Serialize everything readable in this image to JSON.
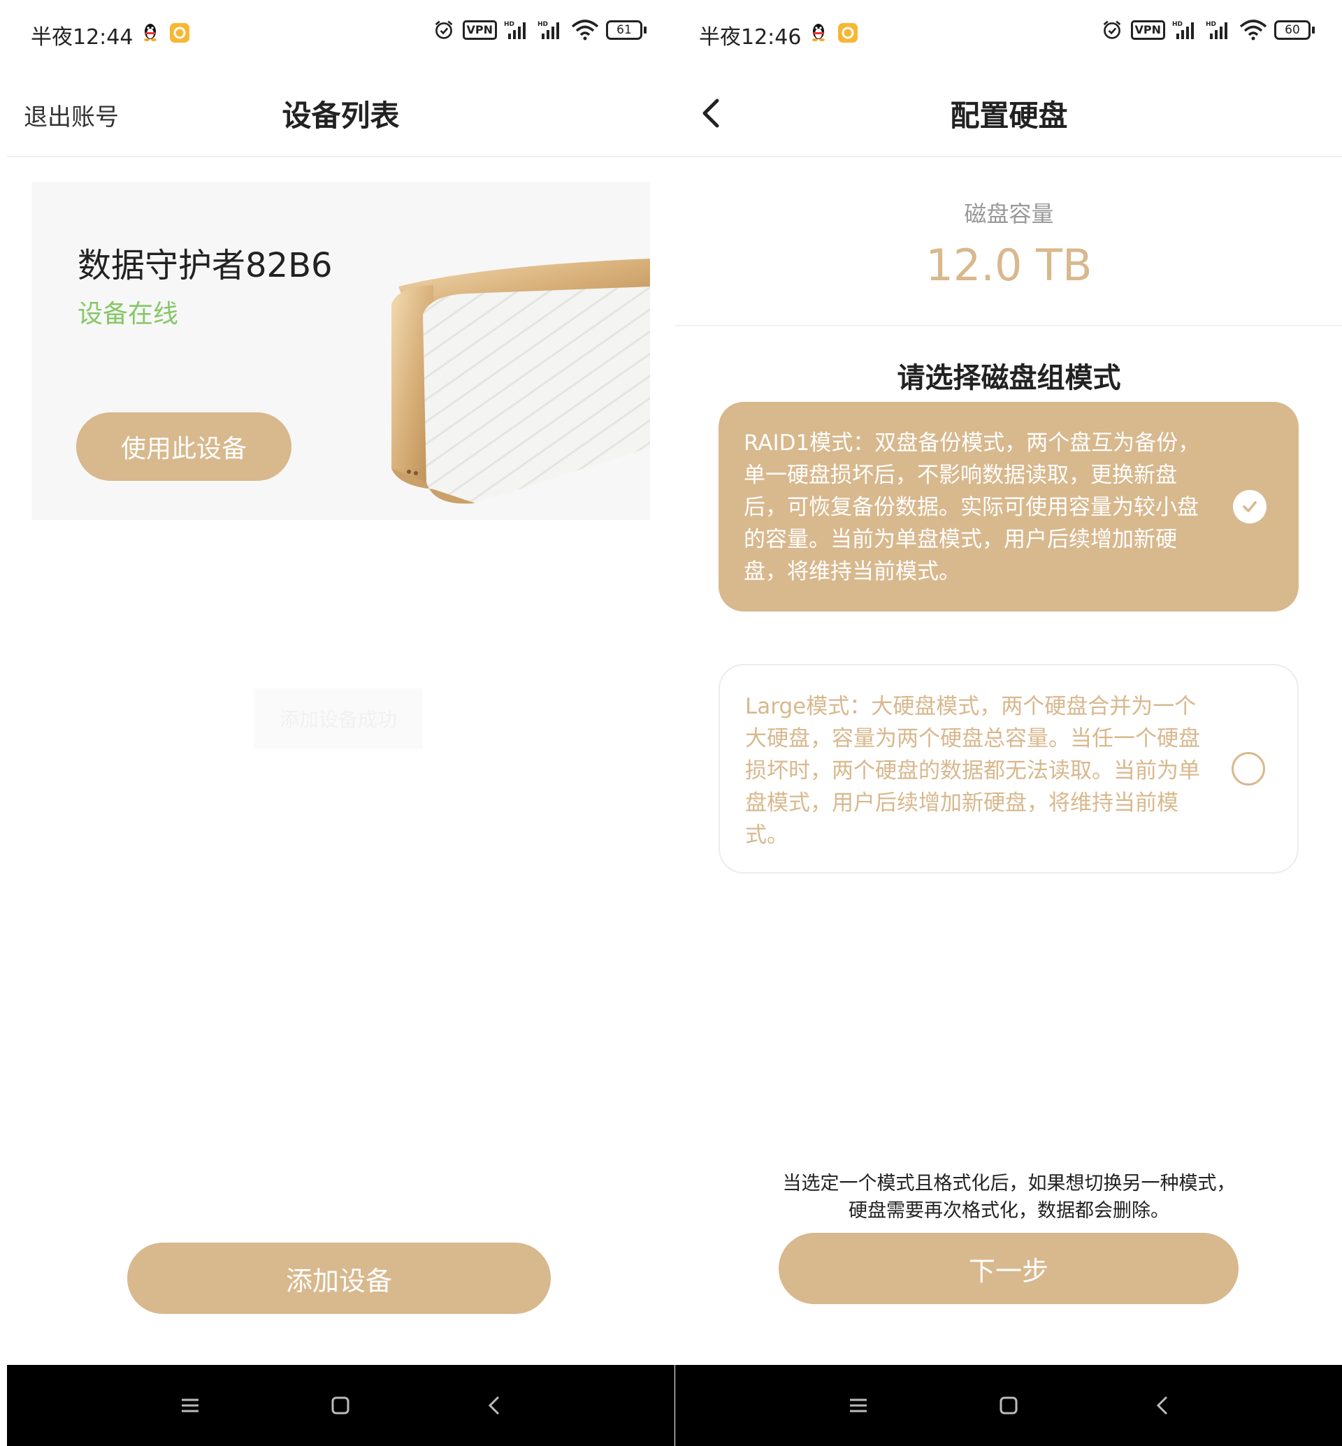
{
  "left": {
    "status_bar": {
      "time": "半夜12:44",
      "battery": "61",
      "vpn": "VPN"
    },
    "header": {
      "logout": "退出账号",
      "title": "设备列表"
    },
    "device_card": {
      "name": "数据守护者82B6",
      "status": "设备在线",
      "use_button": "使用此设备"
    },
    "toast": "添加设备成功",
    "add_button": "添加设备"
  },
  "right": {
    "status_bar": {
      "time": "半夜12:46",
      "battery": "60",
      "vpn": "VPN"
    },
    "header": {
      "title": "配置硬盘"
    },
    "disk": {
      "label": "磁盘容量",
      "value": "12.0 TB"
    },
    "mode_title": "请选择磁盘组模式",
    "modes": [
      {
        "text": "RAID1模式：双盘备份模式，两个盘互为备份，单一硬盘损坏后，不影响数据读取，更换新盘后，可恢复备份数据。实际可使用容量为较小盘的容量。当前为单盘模式，用户后续增加新硬盘，将维持当前模式。",
        "selected": true
      },
      {
        "text": "Large模式：大硬盘模式，两个硬盘合并为一个大硬盘，容量为两个硬盘总容量。当任一个硬盘损坏时，两个硬盘的数据都无法读取。当前为单盘模式，用户后续增加新硬盘，将维持当前模式。",
        "selected": false
      }
    ],
    "warning_line1": "当选定一个模式且格式化后，如果想切换另一种模式，",
    "warning_line2": "硬盘需要再次格式化，数据都会删除。",
    "next_button": "下一步"
  },
  "colors": {
    "accent": "#d8b88d",
    "online": "#86c767",
    "navbar": "#000000"
  },
  "icons": [
    "qq-penguin-icon",
    "app-badge-icon",
    "alarm-icon",
    "signal-icon",
    "wifi-icon",
    "battery-icon",
    "back-arrow-icon",
    "check-icon",
    "menu-icon",
    "home-icon",
    "nav-back-icon"
  ]
}
